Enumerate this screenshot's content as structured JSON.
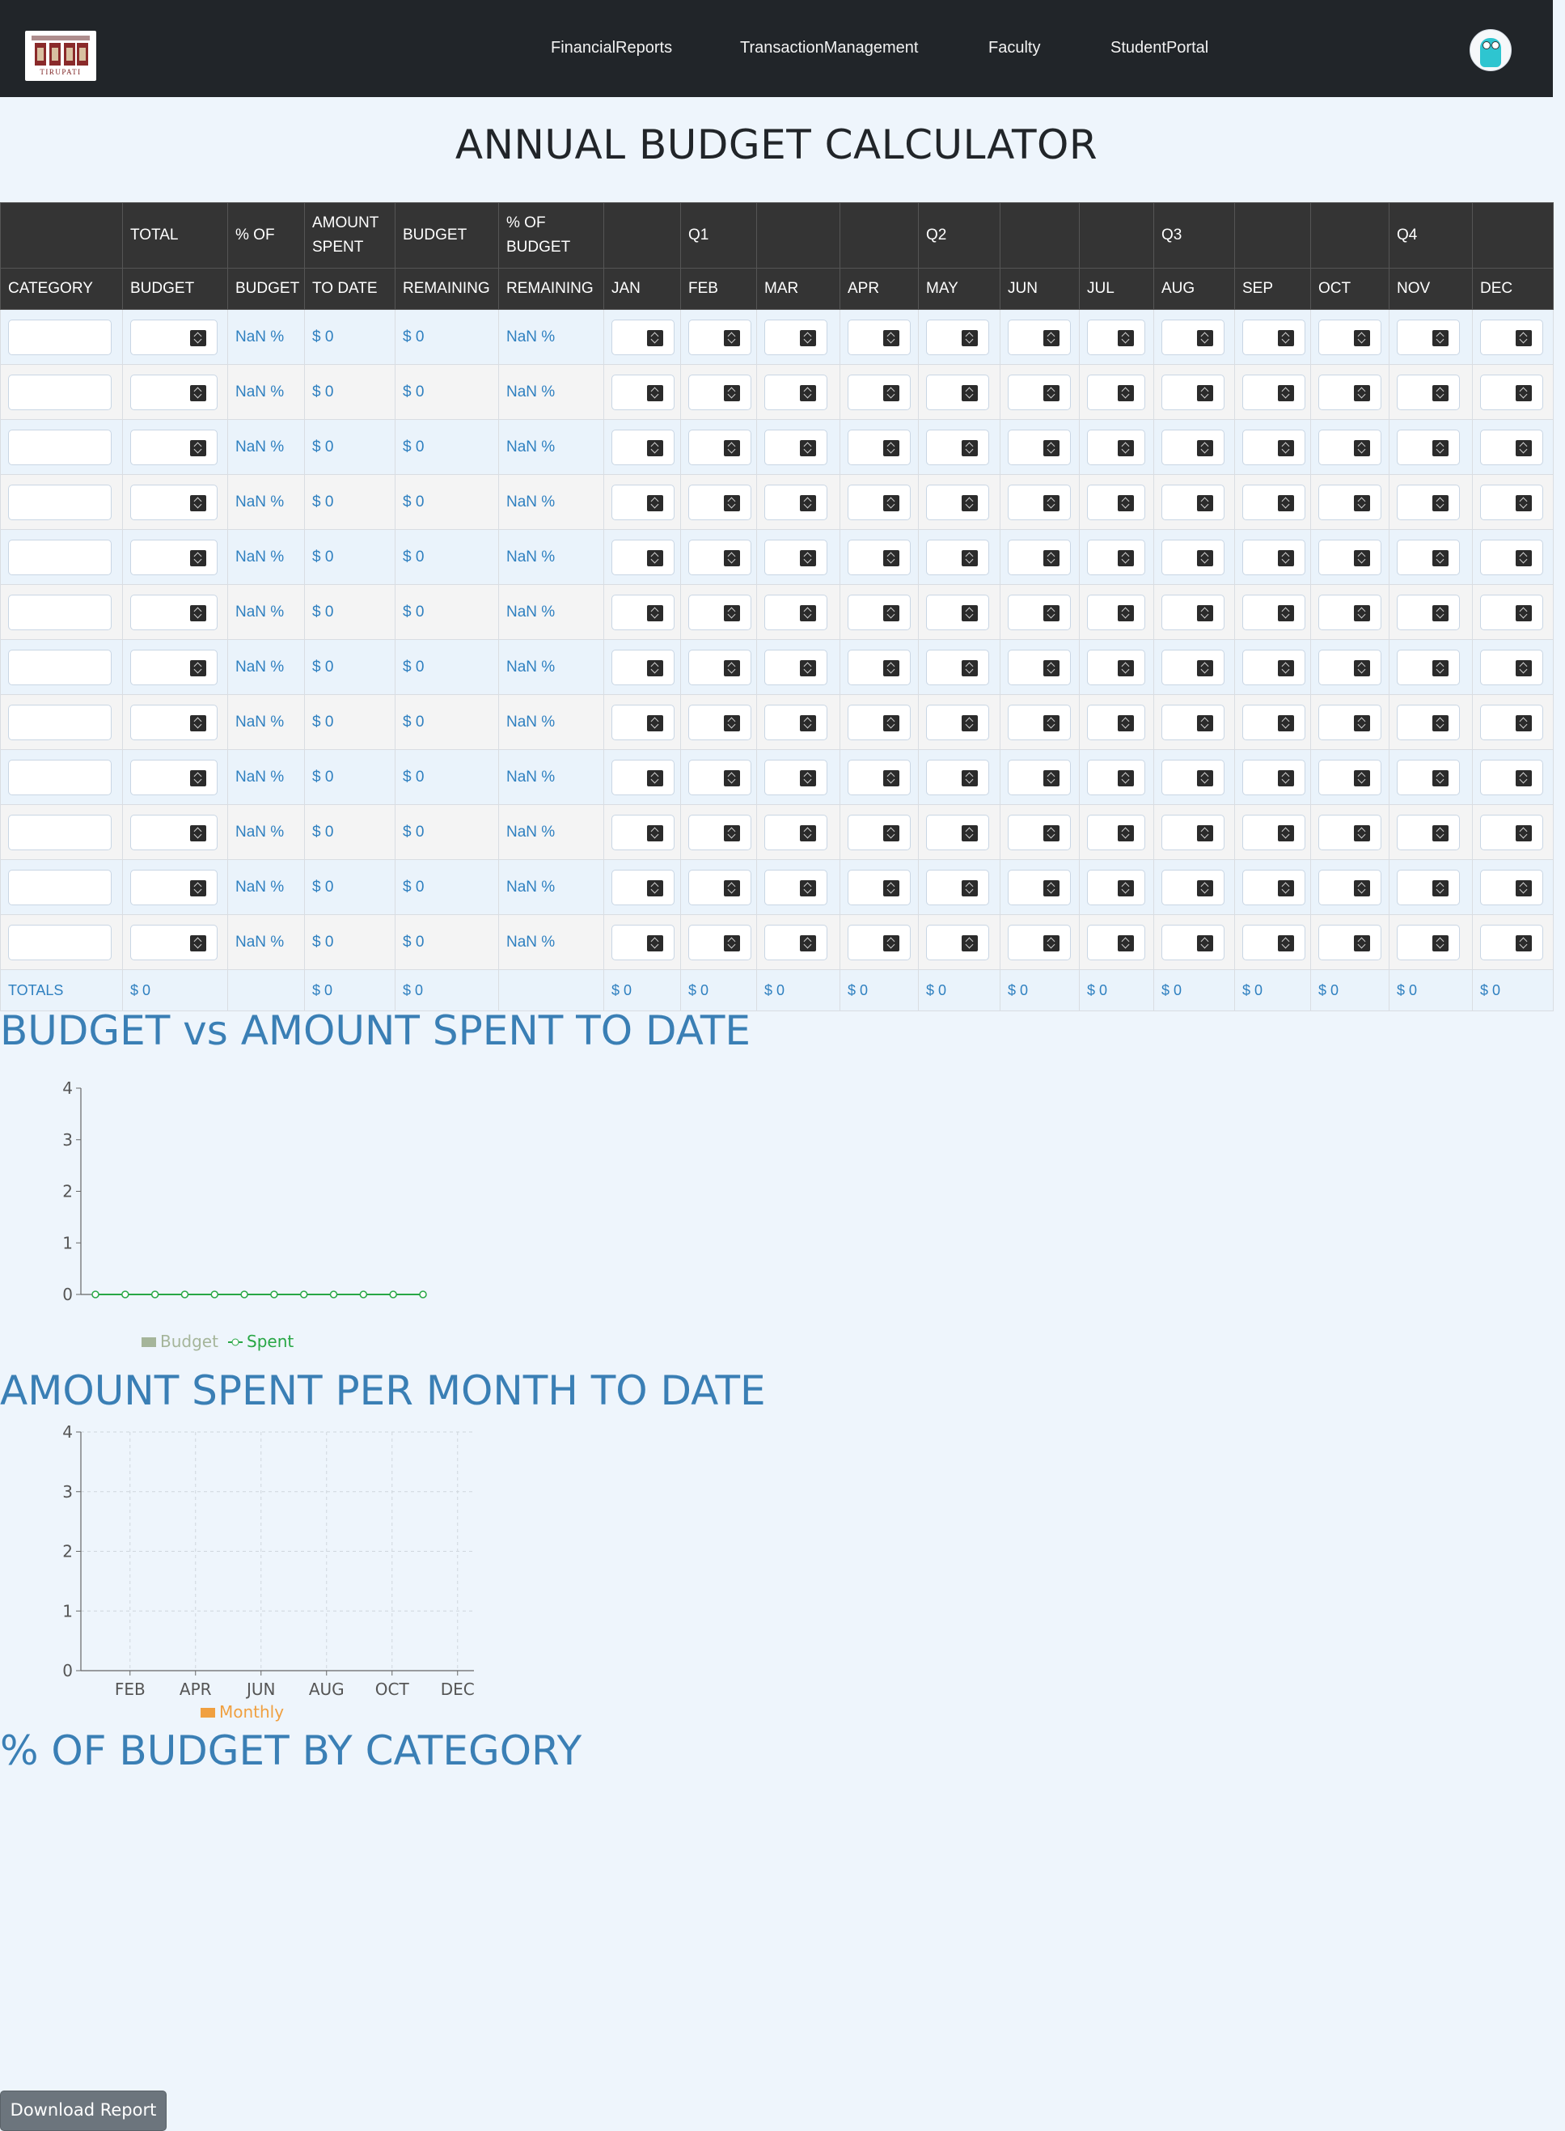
{
  "nav": {
    "logo_text": "TIRUPATI",
    "links": [
      "FinancialReports",
      "TransactionManagement",
      "Faculty",
      "StudentPortal"
    ]
  },
  "page_title": "ANNUAL BUDGET CALCULATOR",
  "table": {
    "header_row1": [
      "",
      "TOTAL",
      "% OF",
      "AMOUNT SPENT",
      "BUDGET",
      "% OF BUDGET",
      "",
      "Q1",
      "",
      "",
      "Q2",
      "",
      "",
      "Q3",
      "",
      "",
      "Q4",
      ""
    ],
    "header_row2": [
      "CATEGORY",
      "BUDGET",
      "BUDGET",
      "TO DATE",
      "REMAINING",
      "REMAINING",
      "JAN",
      "FEB",
      "MAR",
      "APR",
      "MAY",
      "JUN",
      "JUL",
      "AUG",
      "SEP",
      "OCT",
      "NOV",
      "DEC"
    ],
    "row_count": 12,
    "row_values": {
      "pct_of_budget": "NaN %",
      "amount_spent": "$ 0",
      "budget_remaining": "$ 0",
      "pct_remaining": "NaN %"
    },
    "totals_label": "TOTALS",
    "totals": [
      "$ 0",
      "",
      "$ 0",
      "$ 0",
      "",
      "$ 0",
      "$ 0",
      "$ 0",
      "$ 0",
      "$ 0",
      "$ 0",
      "$ 0",
      "$ 0",
      "$ 0",
      "$ 0",
      "$ 0",
      "$ 0"
    ]
  },
  "sections": {
    "budget_vs_spent": "BUDGET vs AMOUNT SPENT TO DATE",
    "spent_per_month": "AMOUNT SPENT PER MONTH TO DATE",
    "pct_by_category": "% OF BUDGET BY CATEGORY"
  },
  "download_button": "Download Report",
  "colors": {
    "navbar": "#212529",
    "heading_blue": "#3a7fb5",
    "budget_series": "#a5b59a",
    "spent_series": "#28a745",
    "monthly_series": "#f0a040"
  },
  "chart_data": [
    {
      "type": "line",
      "title": "BUDGET vs AMOUNT SPENT TO DATE",
      "x": [
        "",
        "",
        "",
        "",
        "",
        "",
        "",
        "",
        "",
        "",
        "",
        ""
      ],
      "ylim": [
        0,
        4
      ],
      "yticks": [
        "0",
        "1",
        "2",
        "3",
        "4"
      ],
      "grid": false,
      "legend": "bottom",
      "series": [
        {
          "name": "Budget",
          "type": "bar",
          "values": [
            0,
            0,
            0,
            0,
            0,
            0,
            0,
            0,
            0,
            0,
            0,
            0
          ]
        },
        {
          "name": "Spent",
          "type": "line",
          "values": [
            0,
            0,
            0,
            0,
            0,
            0,
            0,
            0,
            0,
            0,
            0,
            0
          ]
        }
      ]
    },
    {
      "type": "bar",
      "title": "AMOUNT SPENT PER MONTH TO DATE",
      "categories": [
        "JAN",
        "FEB",
        "MAR",
        "APR",
        "MAY",
        "JUN",
        "JUL",
        "AUG",
        "SEP",
        "OCT",
        "NOV",
        "DEC"
      ],
      "xtick_labels": [
        "FEB",
        "APR",
        "JUN",
        "AUG",
        "OCT",
        "DEC"
      ],
      "ylim": [
        0,
        4
      ],
      "yticks": [
        "0",
        "1",
        "2",
        "3",
        "4"
      ],
      "grid": true,
      "legend": "bottom",
      "series": [
        {
          "name": "Monthly",
          "values": [
            0,
            0,
            0,
            0,
            0,
            0,
            0,
            0,
            0,
            0,
            0,
            0
          ]
        }
      ]
    }
  ]
}
